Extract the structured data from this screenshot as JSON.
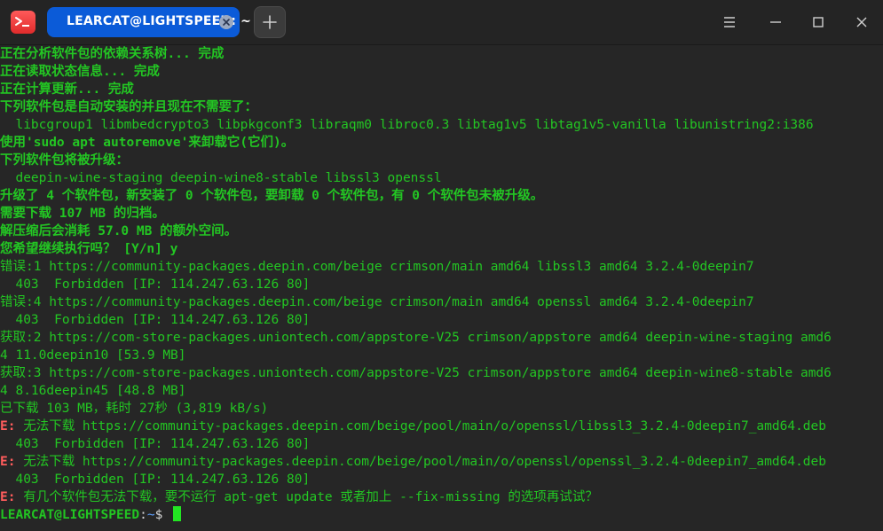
{
  "titlebar": {
    "tab_title": "LEARCAT@LIGHTSPEED: ~",
    "icons": {
      "app": "terminal-app-icon",
      "tab_close": "close-icon",
      "new_tab": "plus-icon",
      "menu": "hamburger-menu-icon",
      "minimize": "minimize-icon",
      "maximize": "maximize-icon",
      "close": "close-icon"
    },
    "colors": {
      "tab_bg": "#0b5bd8",
      "app_icon": "#e84040"
    }
  },
  "terminal": {
    "colors": {
      "text": "#22c522",
      "error": "#ff5c5c",
      "path": "#5ea0ff",
      "background": "#262626"
    },
    "lines": [
      "正在分析软件包的依赖关系树... 完成",
      "正在读取状态信息... 完成",
      "正在计算更新... 完成",
      "下列软件包是自动安装的并且现在不需要了：",
      "  libcgroup1 libmbedcrypto3 libpkgconf3 libraqm0 libroc0.3 libtag1v5 libtag1v5-vanilla libunistring2:i386",
      "使用'sudo apt autoremove'来卸载它(它们)。",
      "下列软件包将被升级：",
      "  deepin-wine-staging deepin-wine8-stable libssl3 openssl",
      "升级了 4 个软件包，新安装了 0 个软件包，要卸载 0 个软件包，有 0 个软件包未被升级。",
      "需要下载 107 MB 的归档。",
      "解压缩后会消耗 57.0 MB 的额外空间。",
      "您希望继续执行吗？ [Y/n] y",
      "错误:1 https://community-packages.deepin.com/beige crimson/main amd64 libssl3 amd64 3.2.4-0deepin7",
      "  403  Forbidden [IP: 114.247.63.126 80]",
      "错误:4 https://community-packages.deepin.com/beige crimson/main amd64 openssl amd64 3.2.4-0deepin7",
      "  403  Forbidden [IP: 114.247.63.126 80]",
      "获取:2 https://com-store-packages.uniontech.com/appstore-V25 crimson/appstore amd64 deepin-wine-staging amd6",
      "4 11.0deepin10 [53.9 MB]",
      "获取:3 https://com-store-packages.uniontech.com/appstore-V25 crimson/appstore amd64 deepin-wine8-stable amd6",
      "4 8.16deepin45 [48.8 MB]",
      "已下载 103 MB，耗时 27秒 (3,819 kB/s)",
      "无法下载 https://community-packages.deepin.com/beige/pool/main/o/openssl/libssl3_3.2.4-0deepin7_amd64.deb",
      "  403  Forbidden [IP: 114.247.63.126 80]",
      "无法下载 https://community-packages.deepin.com/beige/pool/main/o/openssl/openssl_3.2.4-0deepin7_amd64.deb",
      "  403  Forbidden [IP: 114.247.63.126 80]",
      "有几个软件包无法下载，要不运行 apt-get update 或者加上 --fix-missing 的选项再试试？"
    ],
    "error_prefix": "E: ",
    "prompt": {
      "user_host": "LEARCAT@LIGHTSPEED",
      "sep": ":",
      "path": "~",
      "dollar": "$ "
    }
  }
}
